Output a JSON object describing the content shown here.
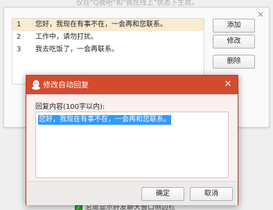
{
  "background": {
    "top_hint": "仅在\"Q我吧\"和\"我在线上\"状态下生效。",
    "close_icon": "close-icon",
    "replies": [
      {
        "num": "1",
        "text": "您好，我现在有事不在，一会再和您联系。",
        "selected": true
      },
      {
        "num": "2",
        "text": "工作中，请勿打扰。",
        "selected": false
      },
      {
        "num": "3",
        "text": "我去吃饭了，一会再联系。",
        "selected": false
      }
    ],
    "buttons": {
      "add": "添加",
      "edit": "修改",
      "delete": "删除"
    },
    "footer_hint": "总是显示好友聊天窗口侧边栏"
  },
  "dialog": {
    "title": "修改自动回复",
    "field_label": "回复内容(100字以内):",
    "content": "您好，我现在有事不在，一会再和您联系。",
    "ok": "确定",
    "cancel": "取消",
    "colors": {
      "titlebar": "#d34b2f",
      "selection": "#3399ff"
    }
  }
}
